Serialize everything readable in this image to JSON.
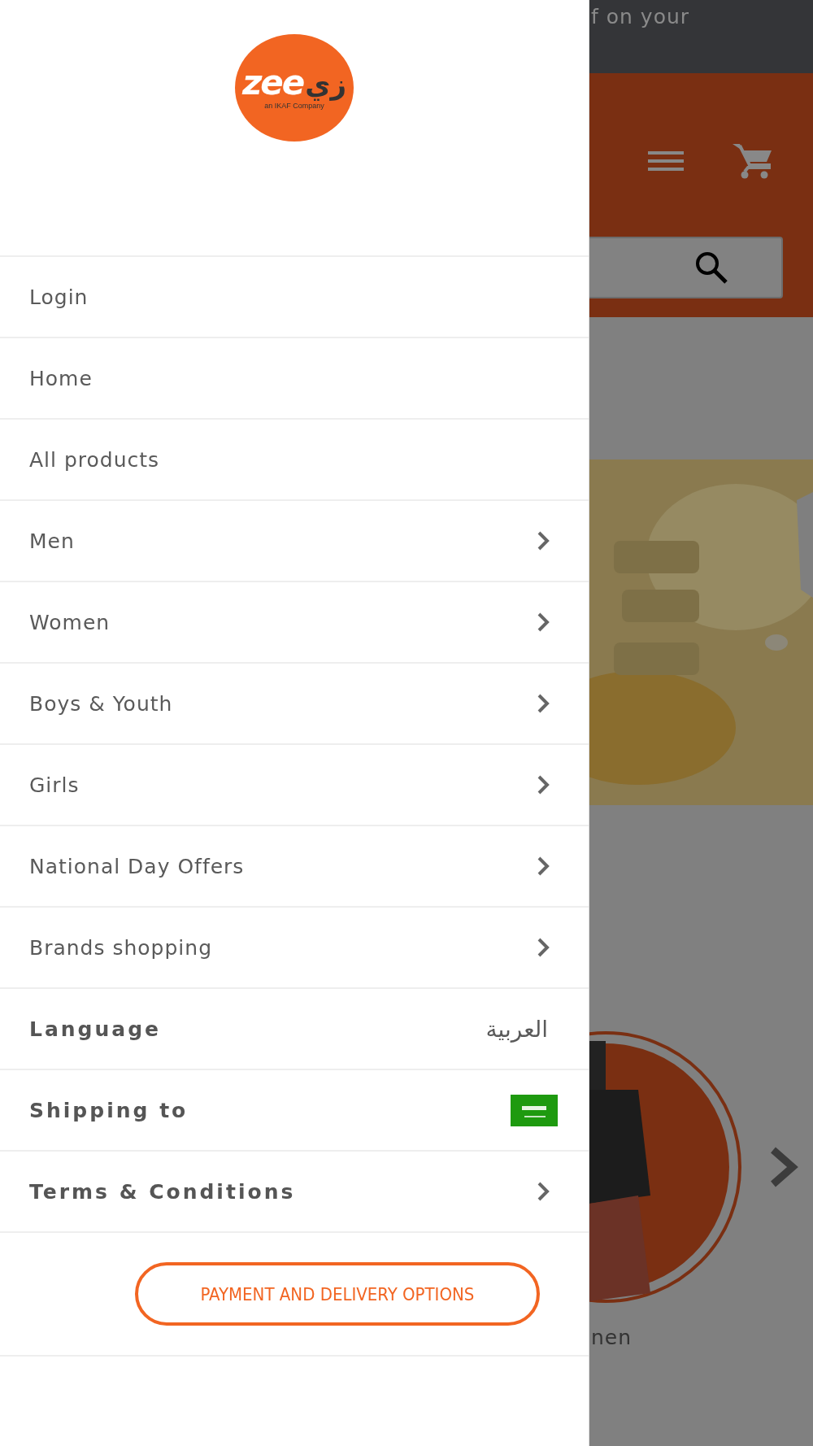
{
  "drawer": {
    "logo": {
      "wordmark": "zee",
      "wordmark_arabic": "زي",
      "tagline": "an IKAF Company"
    },
    "nav_items": [
      {
        "label": "Login",
        "kind": "link"
      },
      {
        "label": "Home",
        "kind": "link"
      },
      {
        "label": "All products",
        "kind": "link"
      },
      {
        "label": "Men",
        "kind": "submenu"
      },
      {
        "label": "Women",
        "kind": "submenu"
      },
      {
        "label": "Boys & Youth",
        "kind": "submenu"
      },
      {
        "label": "Girls",
        "kind": "submenu"
      },
      {
        "label": "National Day Offers",
        "kind": "submenu"
      },
      {
        "label": "Brands shopping",
        "kind": "submenu"
      }
    ],
    "settings_items": [
      {
        "label": "Language",
        "kind": "value",
        "value": "العربية"
      },
      {
        "label": "Shipping to",
        "kind": "flag"
      },
      {
        "label": "Terms & Conditions",
        "kind": "submenu"
      }
    ],
    "button": "PAYMENT AND DELIVERY OPTIONS"
  },
  "page": {
    "announcement": "f on your",
    "category_caption": "nen"
  }
}
